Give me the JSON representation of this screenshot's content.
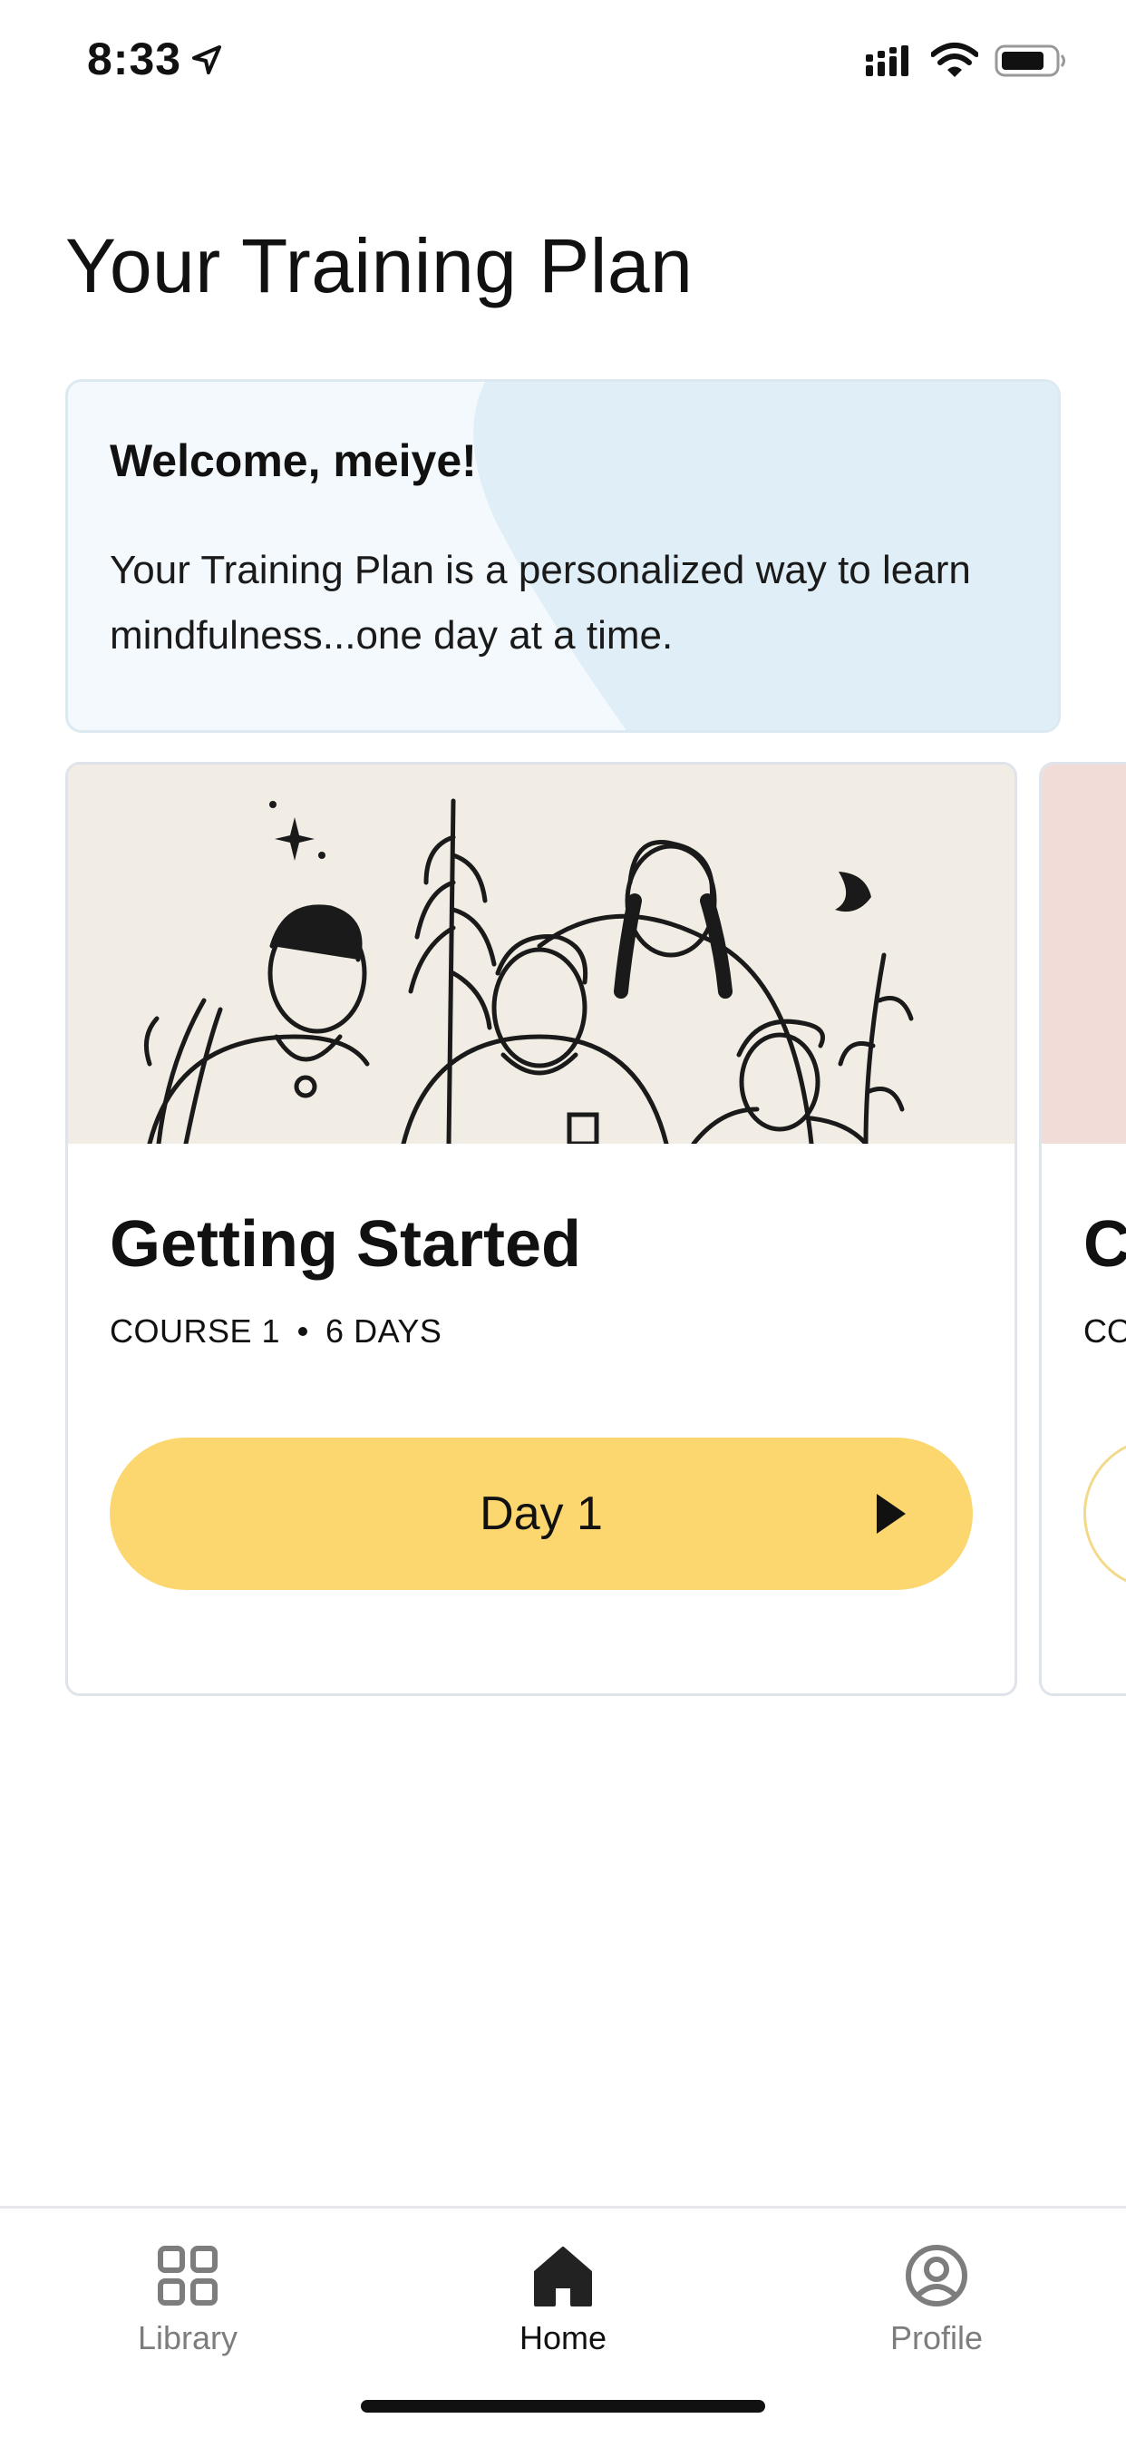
{
  "status_bar": {
    "time": "8:33"
  },
  "page": {
    "title": "Your Training Plan"
  },
  "welcome": {
    "title": "Welcome, meiye!",
    "text": "Your Training Plan is a personalized way to learn mindfulness...one day at a time."
  },
  "courses": [
    {
      "title": "Getting Started",
      "course_label": "COURSE 1",
      "duration": "6 DAYS",
      "button_label": "Day 1"
    },
    {
      "title": "C",
      "course_label": "CO"
    }
  ],
  "tabs": [
    {
      "label": "Library",
      "icon": "grid-icon",
      "active": false
    },
    {
      "label": "Home",
      "icon": "home-icon",
      "active": true
    },
    {
      "label": "Profile",
      "icon": "profile-icon",
      "active": false
    }
  ],
  "colors": {
    "accent_button": "#fcd76f",
    "welcome_bg": "#e0eff7",
    "art_bg": "#f2ede4",
    "next_art_bg": "#f1dcd7"
  }
}
